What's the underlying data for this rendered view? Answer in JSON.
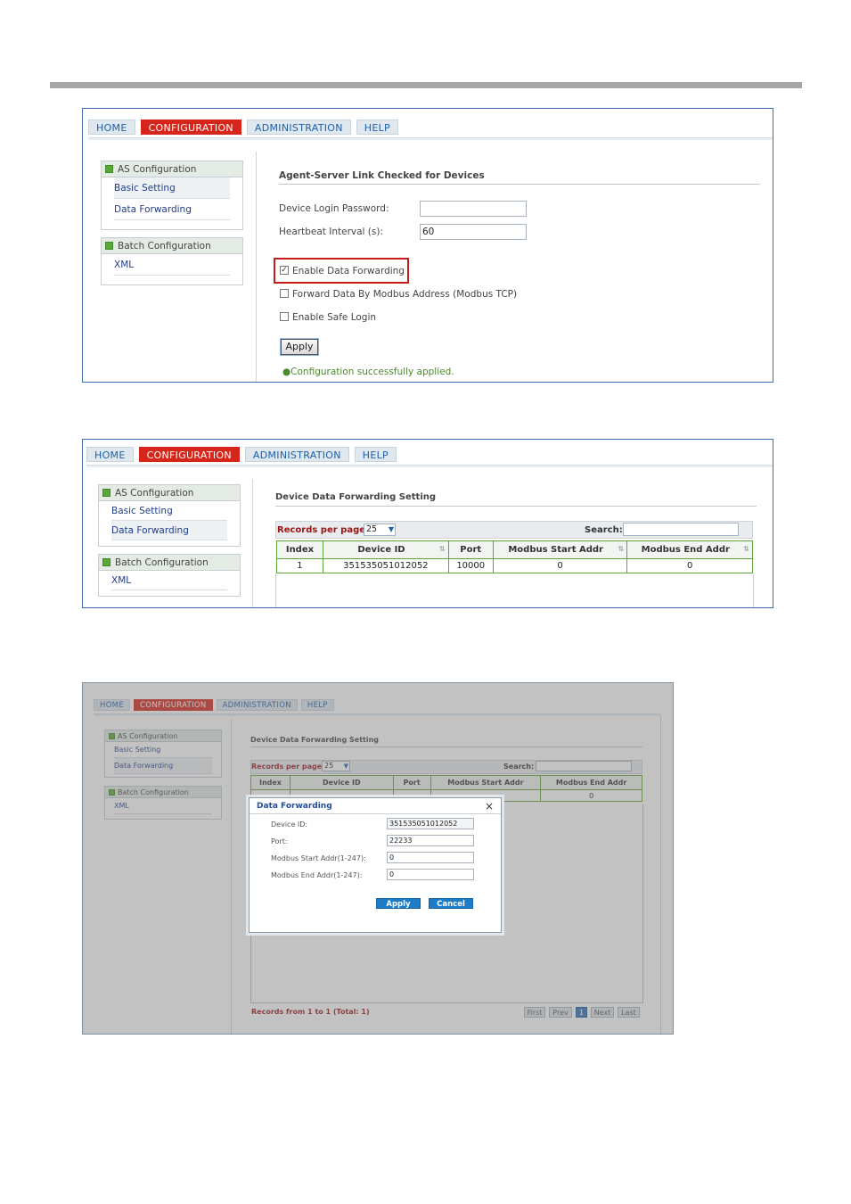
{
  "nav": {
    "home": "HOME",
    "config": "CONFIGURATION",
    "admin": "ADMINISTRATION",
    "help": "HELP"
  },
  "sidebar": {
    "as_config": "AS Configuration",
    "basic_setting": "Basic Setting",
    "data_forwarding": "Data Forwarding",
    "batch_config": "Batch Configuration",
    "xml": "XML"
  },
  "screen1": {
    "section_title": "Agent-Server Link Checked for Devices",
    "login_password_label": "Device Login Password:",
    "login_password_value": "",
    "heartbeat_label": "Heartbeat Interval (s):",
    "heartbeat_value": "60",
    "enable_forwarding": "Enable Data Forwarding",
    "forward_modbus": "Forward Data By Modbus Address (Modbus TCP)",
    "safe_login": "Enable Safe Login",
    "apply": "Apply",
    "success": "Configuration successfully applied."
  },
  "screen2": {
    "section_title": "Device Data Forwarding Setting",
    "records_label": "Records per page:",
    "records_value": "25",
    "search_label": "Search:",
    "columns": [
      "Index",
      "Device ID",
      "Port",
      "Modbus Start Addr",
      "Modbus End Addr"
    ],
    "rows": [
      [
        "1",
        "351535051012052",
        "10000",
        "0",
        "0"
      ]
    ]
  },
  "screen3": {
    "section_title": "Device Data Forwarding Setting",
    "records_label": "Records per page:",
    "records_value": "25",
    "search_label": "Search:",
    "columns": [
      "Index",
      "Device ID",
      "Port",
      "Modbus Start Addr",
      "Modbus End Addr"
    ],
    "row_end": "0",
    "footer": "Records from 1 to 1 (Total: 1)",
    "pager": {
      "first": "First",
      "prev": "Prev",
      "page": "1",
      "next": "Next",
      "last": "Last"
    },
    "dialog": {
      "title": "Data Forwarding",
      "close": "×",
      "device_id_label": "Device ID:",
      "device_id_value": "351535051012052",
      "port_label": "Port:",
      "port_value": "22233",
      "start_label": "Modbus Start Addr(1-247):",
      "start_value": "0",
      "end_label": "Modbus End Addr(1-247):",
      "end_value": "0",
      "apply": "Apply",
      "cancel": "Cancel"
    }
  },
  "colors": {
    "accent_red": "#d6251a",
    "link_blue": "#1f5fa8",
    "table_green": "#5fa43a",
    "button_blue": "#1d7cc8"
  }
}
